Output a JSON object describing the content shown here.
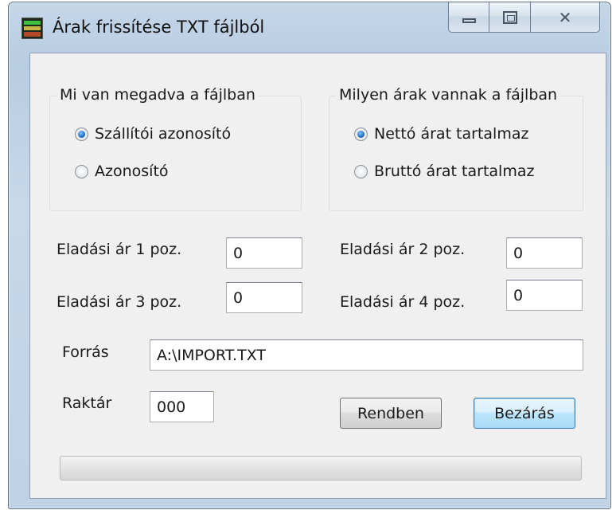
{
  "window": {
    "title": "Árak frissítése TXT fájlból",
    "icon": "app-icon"
  },
  "group_content": {
    "legend": "Mi van megadva a fájlban",
    "options": [
      {
        "label": "Szállítói azonosító",
        "checked": true
      },
      {
        "label": "Azonosító",
        "checked": false
      }
    ]
  },
  "group_price": {
    "legend": "Milyen árak vannak a fájlban",
    "options": [
      {
        "label": "Nettó árat tartalmaz",
        "checked": true
      },
      {
        "label": "Bruttó árat tartalmaz",
        "checked": false
      }
    ]
  },
  "prices": [
    {
      "label": "Eladási ár 1 poz.",
      "value": "0"
    },
    {
      "label": "Eladási ár 2 poz.",
      "value": "0"
    },
    {
      "label": "Eladási ár 3 poz.",
      "value": "0"
    },
    {
      "label": "Eladási ár 4 poz.",
      "value": "0"
    }
  ],
  "source": {
    "label": "Forrás",
    "value": "A:\\IMPORT.TXT"
  },
  "warehouse": {
    "label": "Raktár",
    "value": "000"
  },
  "buttons": {
    "ok": "Rendben",
    "close": "Bezárás"
  },
  "progress": {
    "value": 0
  }
}
